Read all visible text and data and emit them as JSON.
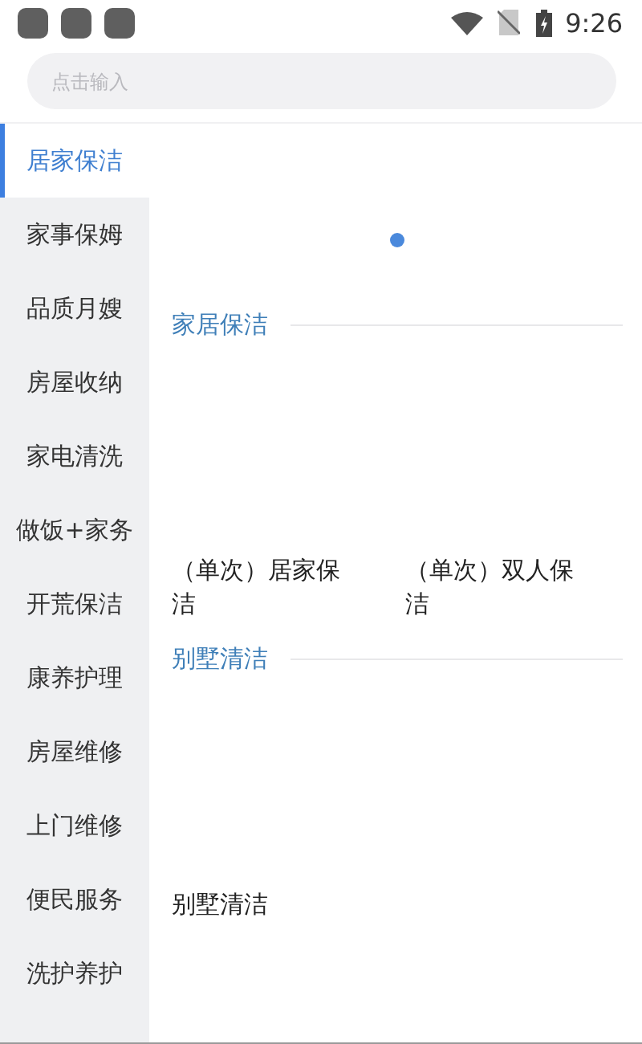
{
  "status_bar": {
    "time": "9:26"
  },
  "search": {
    "placeholder": "点击输入"
  },
  "sidebar": {
    "items": [
      {
        "label": "居家保洁",
        "selected": true
      },
      {
        "label": "家事保姆",
        "selected": false
      },
      {
        "label": "品质月嫂",
        "selected": false
      },
      {
        "label": "房屋收纳",
        "selected": false
      },
      {
        "label": "家电清洗",
        "selected": false
      },
      {
        "label": "做饭+家务",
        "selected": false
      },
      {
        "label": "开荒保洁",
        "selected": false
      },
      {
        "label": "康养护理",
        "selected": false
      },
      {
        "label": "房屋维修",
        "selected": false
      },
      {
        "label": "上门维修",
        "selected": false
      },
      {
        "label": "便民服务",
        "selected": false
      },
      {
        "label": "洗护养护",
        "selected": false
      }
    ]
  },
  "sections": [
    {
      "title": "家居保洁",
      "items": [
        {
          "label": "（单次）居家保洁"
        },
        {
          "label": "（单次）双人保洁"
        }
      ]
    },
    {
      "title": "别墅清洁",
      "items": [
        {
          "label": "别墅清洁"
        }
      ]
    }
  ]
}
